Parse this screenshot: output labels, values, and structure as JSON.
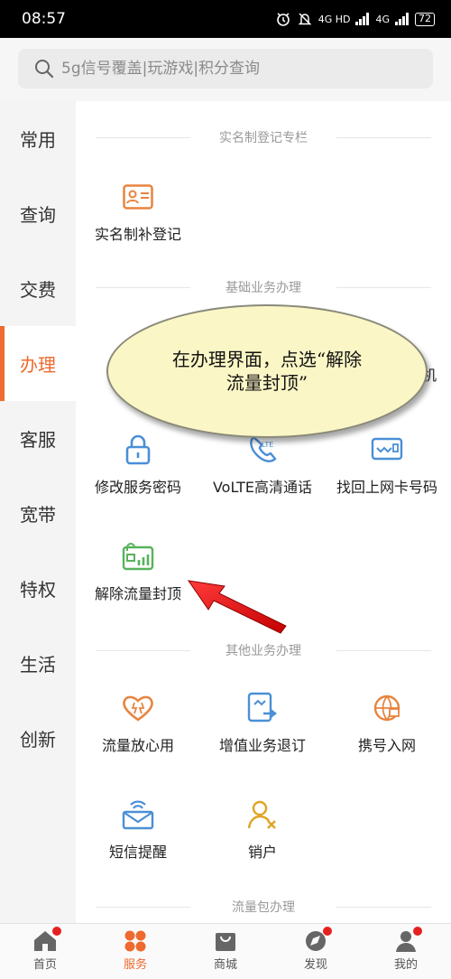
{
  "status": {
    "time": "08:57",
    "network_a": "4G HD",
    "network_b": "4G",
    "battery": "72"
  },
  "search": {
    "placeholder": "5g信号覆盖|玩游戏|积分查询"
  },
  "sidebar": {
    "items": [
      {
        "label": "常用"
      },
      {
        "label": "查询"
      },
      {
        "label": "交费"
      },
      {
        "label": "办理"
      },
      {
        "label": "客服"
      },
      {
        "label": "宽带"
      },
      {
        "label": "特权"
      },
      {
        "label": "生活"
      },
      {
        "label": "创新"
      }
    ],
    "active_index": 3
  },
  "sections": {
    "realname": {
      "title": "实名制登记专栏",
      "items": [
        {
          "label": "实名制补登记",
          "icon": "id-card-icon"
        }
      ]
    },
    "basic": {
      "title": "基础业务办理",
      "partial_label": "机",
      "items": [
        {
          "label": "修改服务密码",
          "icon": "lock-icon"
        },
        {
          "label": "VoLTE高清通话",
          "icon": "volte-phone-icon"
        },
        {
          "label": "找回上网卡号码",
          "icon": "sim-card-icon"
        },
        {
          "label": "解除流量封顶",
          "icon": "data-unlock-icon"
        }
      ]
    },
    "other": {
      "title": "其他业务办理",
      "items": [
        {
          "label": "流量放心用",
          "icon": "heart-data-icon"
        },
        {
          "label": "增值业务退订",
          "icon": "unsubscribe-icon"
        },
        {
          "label": "携号入网",
          "icon": "globe-transfer-icon"
        },
        {
          "label": "短信提醒",
          "icon": "sms-envelope-icon"
        },
        {
          "label": "销户",
          "icon": "user-remove-icon"
        }
      ]
    },
    "package": {
      "title": "流量包办理"
    }
  },
  "annotation": {
    "text": "在办理界面，点选“解除流量封顶”"
  },
  "tabbar": {
    "items": [
      {
        "label": "首页",
        "icon": "home-icon",
        "badge": true
      },
      {
        "label": "服务",
        "icon": "service-grid-icon",
        "badge": false
      },
      {
        "label": "商城",
        "icon": "shop-bag-icon",
        "badge": false
      },
      {
        "label": "发现",
        "icon": "compass-icon",
        "badge": true
      },
      {
        "label": "我的",
        "icon": "user-icon",
        "badge": true
      }
    ],
    "active_index": 1
  },
  "colors": {
    "accent": "#ee6a2e",
    "icon_blue": "#4a8fd6",
    "icon_green": "#58b25c",
    "icon_orange": "#e8843e",
    "icon_yellow": "#e0a422"
  }
}
